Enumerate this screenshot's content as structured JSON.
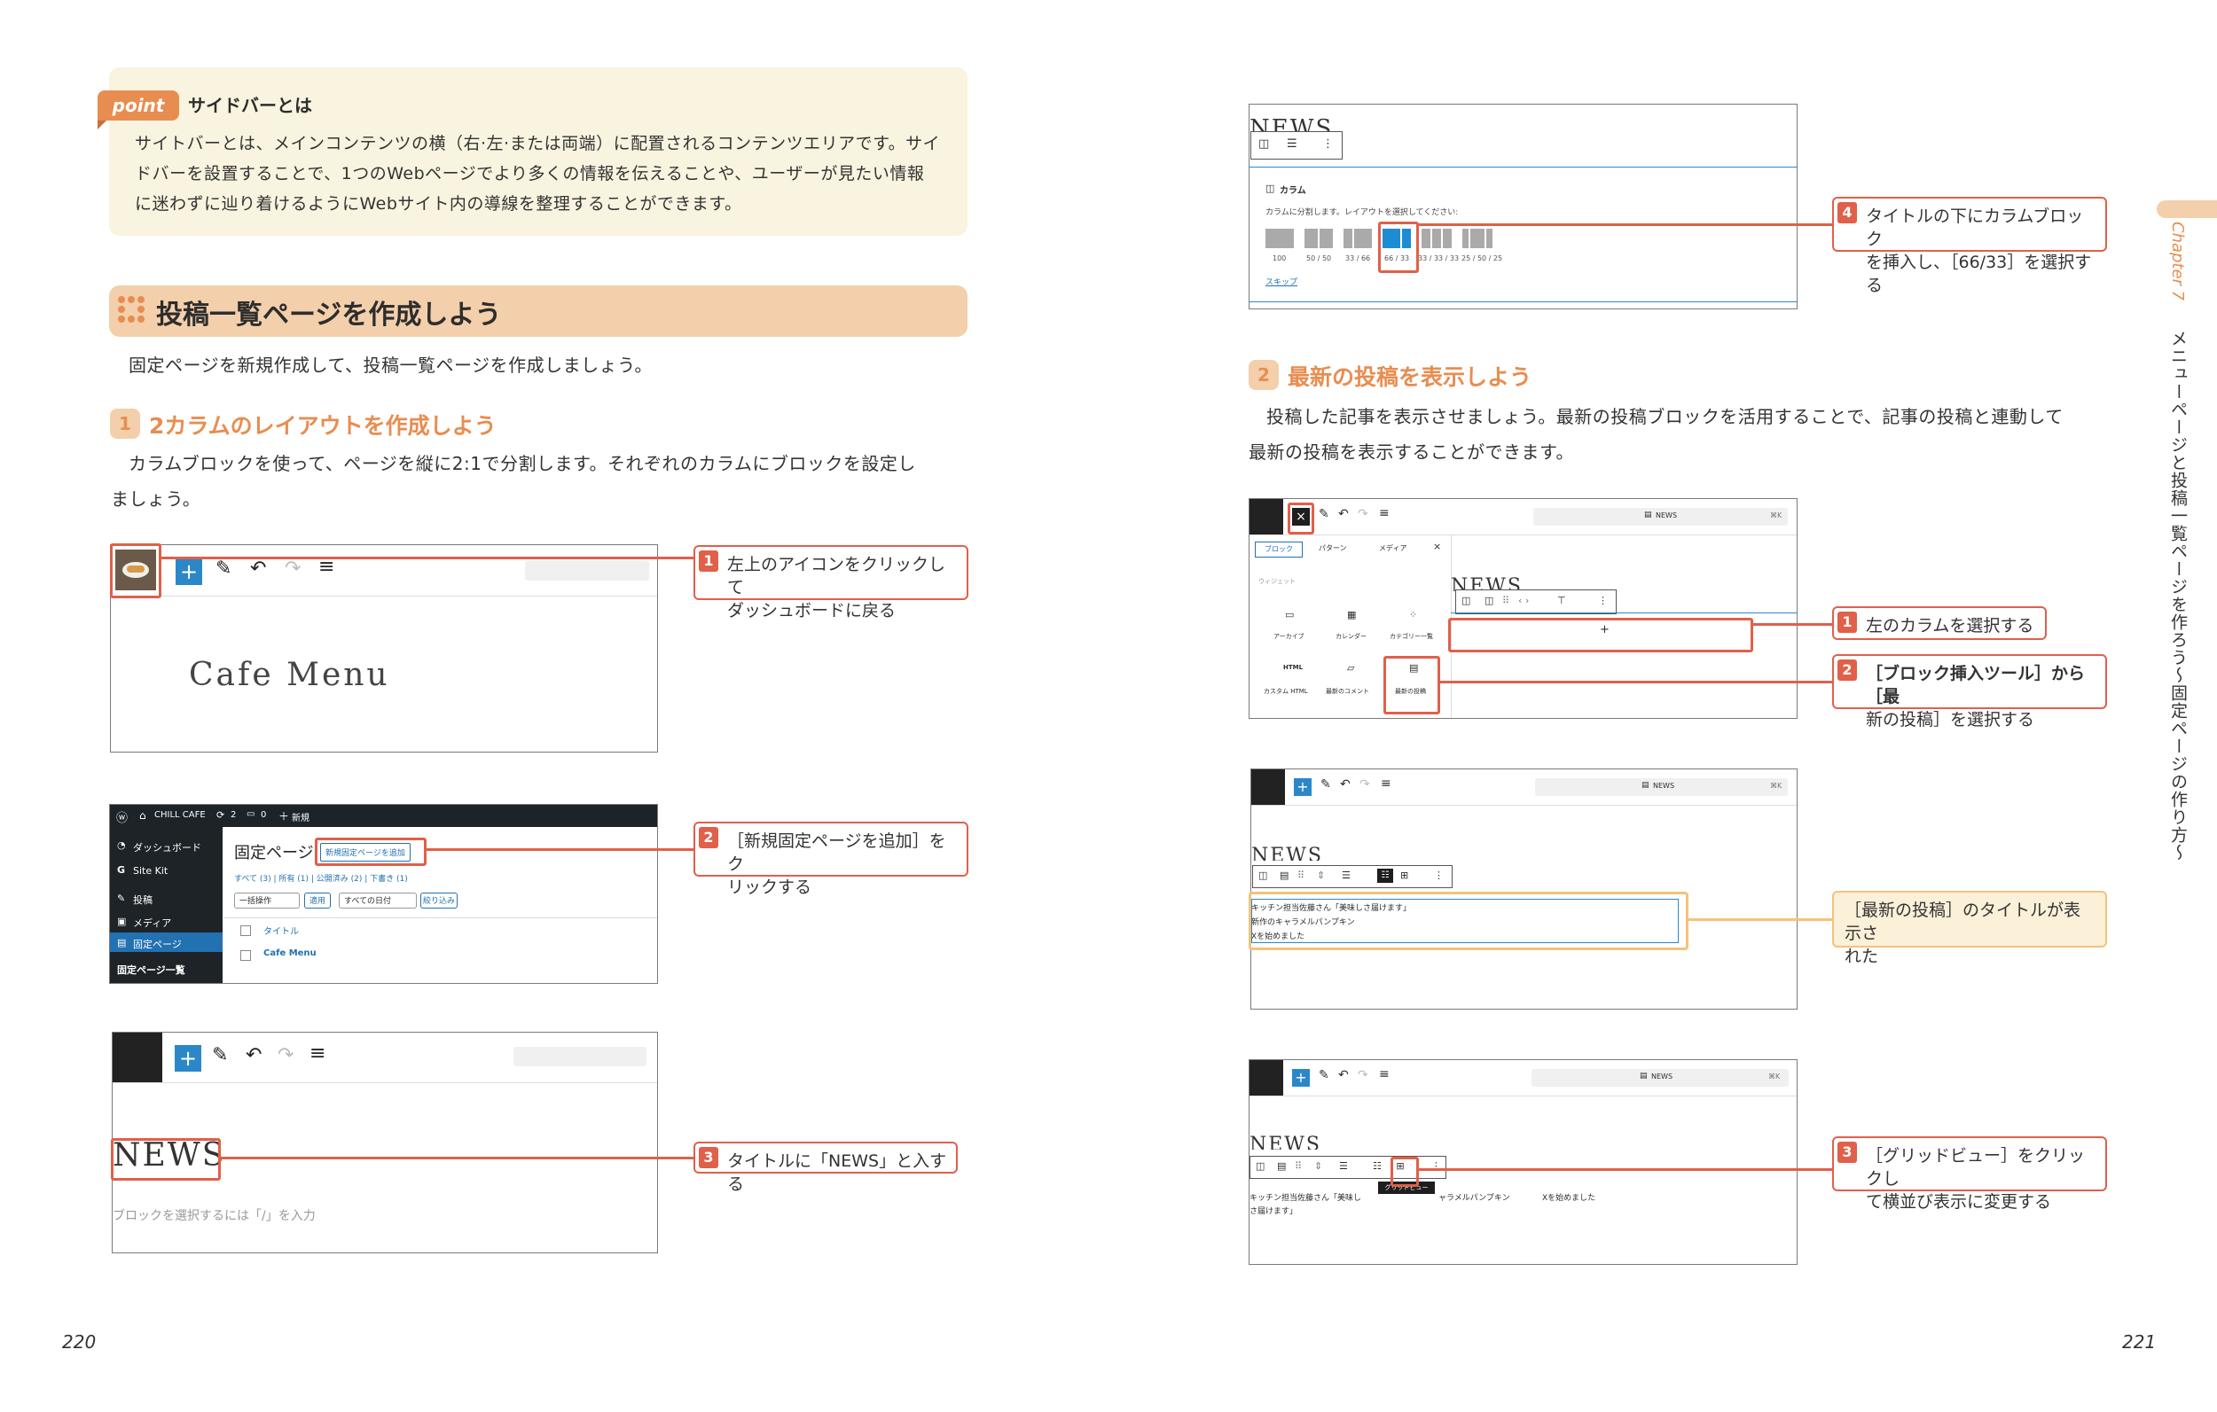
{
  "left": {
    "point": {
      "tag": "point",
      "title": "サイドバーとは",
      "lines": [
        "サイトバーとは、メインコンテンツの横（右·左·または両端）に配置されるコンテンツエリアです。サイ",
        "ドバーを設置することで、1つのWebページでより多くの情報を伝えることや、ユーザーが見たい情報",
        "に迷わずに辿り着けるようにWebサイト内の導線を整理することができます。"
      ]
    },
    "section_title": "投稿一覧ページを作成しよう",
    "section_intro": "固定ページを新規作成して、投稿一覧ページを作成しましょう。",
    "step1": {
      "num": "1",
      "title": "2カラムのレイアウトを作成しよう",
      "lines": [
        "カラムブロックを使って、ページを縦に2:1で分割します。それぞれのカラムにブロックを設定し",
        "ましょう。"
      ]
    },
    "shot1": {
      "title": "Cafe Menu"
    },
    "shot2": {
      "site": "CHILL CAFE",
      "comments": "2",
      "updates": "0",
      "new": "新規",
      "menu": [
        "ダッシュボード",
        "Site Kit",
        "投稿",
        "メディア",
        "固定ページ",
        "固定ページ一覧"
      ],
      "page_heading": "固定ページ",
      "add_new": "新規固定ページを追加",
      "filters": "すべて (3) | 所有 (1) | 公開済み (2) | 下書き (1)",
      "bulk": "一括操作",
      "apply": "適用",
      "dates": "すべての日付",
      "narrow": "絞り込み",
      "col_title": "タイトル",
      "row1": "Cafe Menu"
    },
    "shot3": {
      "title": "NEWS",
      "placeholder": "ブロックを選択するには「/」を入力"
    },
    "callouts": [
      {
        "num": "1",
        "lines": [
          "左上のアイコンをクリックして",
          "ダッシュボードに戻る"
        ]
      },
      {
        "num": "2",
        "lines": [
          "［新規固定ページを追加］をク",
          "リックする"
        ]
      },
      {
        "num": "3",
        "lines": [
          "タイトルに「NEWS」と入する"
        ]
      }
    ],
    "page_number": "220"
  },
  "right": {
    "shot4": {
      "heading": "NEWS",
      "block_name": "カラム",
      "hint": "カラムに分割します。レイアウトを選択してください:",
      "layouts": [
        "100",
        "50 / 50",
        "33 / 66",
        "66 / 33",
        "33 / 33 / 33",
        "25 / 50 / 25"
      ],
      "skip": "スキップ"
    },
    "callout4": {
      "num": "4",
      "lines": [
        "タイトルの下にカラムブロック",
        "を挿入し、［66/33］を選択する"
      ]
    },
    "step2": {
      "num": "2",
      "title": "最新の投稿を表示しよう",
      "lines": [
        "投稿した記事を表示させましょう。最新の投稿ブロックを活用することで、記事の投稿と連動して",
        "最新の投稿を表示することができます。"
      ]
    },
    "shot5": {
      "doc": "NEWS",
      "shortcut": "⌘K",
      "tabs": [
        "ブロック",
        "パターン",
        "メディア"
      ],
      "group": "ウィジェット",
      "blocks": [
        "アーカイブ",
        "カレンダー",
        "カテゴリー一覧",
        "カスタム HTML",
        "最新のコメント",
        "最新の投稿"
      ],
      "heading": "NEWS",
      "plus": "+"
    },
    "shot6": {
      "doc": "NEWS",
      "shortcut": "⌘K",
      "heading": "NEWS",
      "posts": [
        "キッチン担当佐藤さん「美味しさ届けます」",
        "新作のキャラメルパンプキン",
        "Xを始めました"
      ]
    },
    "shot7": {
      "doc": "NEWS",
      "shortcut": "⌘K",
      "heading": "NEWS",
      "grid_a": "キッチン担当佐藤さん「美味し",
      "grid_a2": "さ届けます」",
      "grid_b": "ャラメルパンプキン",
      "grid_c": "Xを始めました",
      "tooltip": "グリッドビュー"
    },
    "callouts": [
      {
        "num": "1",
        "lines": [
          "左のカラムを選択する"
        ]
      },
      {
        "num": "2",
        "lines": [
          "［ブロック挿入ツール］から［最",
          "新の投稿］を選択する"
        ]
      },
      {
        "num": "3",
        "lines": [
          "［グリッドビュー］をクリックし",
          "て横並び表示に変更する"
        ]
      }
    ],
    "note": {
      "lines": [
        "［最新の投稿］のタイトルが表示さ",
        "れた"
      ]
    },
    "chapter": "Chapter 7",
    "side_title": "メニューページと投稿一覧ページを作ろう〜固定ページの作り方〜",
    "page_number": "221"
  }
}
